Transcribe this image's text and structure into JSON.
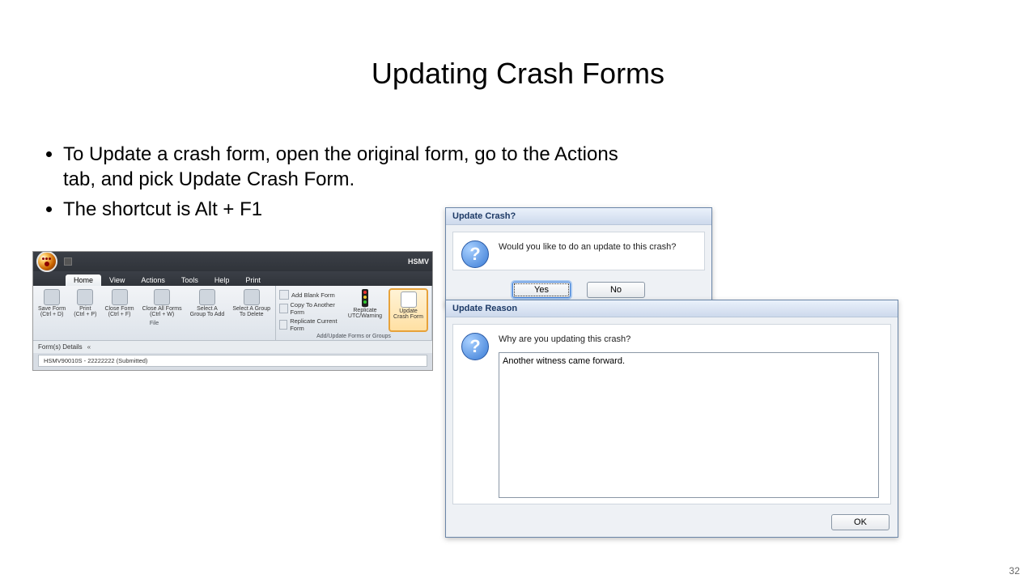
{
  "slide": {
    "title": "Updating Crash Forms",
    "bullets": [
      "To Update a crash form, open the original form, go to the Actions tab, and pick Update Crash Form.",
      "The shortcut is Alt + F1"
    ],
    "page_number": "32"
  },
  "ribbon": {
    "app_title_fragment": "HSMV",
    "tabs": [
      "Home",
      "View",
      "Actions",
      "Tools",
      "Help",
      "Print"
    ],
    "active_tab": "Home",
    "file_group": {
      "name": "File",
      "buttons": [
        {
          "label": "Save Form\n(Ctrl + D)"
        },
        {
          "label": "Print\n(Ctrl + P)"
        },
        {
          "label": "Close Form\n(Ctrl + F)"
        },
        {
          "label": "Close All Forms\n(Ctrl + W)"
        },
        {
          "label": "Select A\nGroup To Add"
        },
        {
          "label": "Select A Group\nTo Delete"
        }
      ]
    },
    "add_group": {
      "name": "Add/Update Forms or Groups",
      "links": [
        "Add Blank Form",
        "Copy To Another Form",
        "Replicate Current Form"
      ],
      "buttons": [
        {
          "label": "Replicate\nUTC/Warning"
        },
        {
          "label": "Update\nCrash Form"
        }
      ]
    },
    "panel_header": "Form(s) Details",
    "panel_collapse": "«",
    "open_doc": "HSMV90010S - 22222222 (Submitted)"
  },
  "update_dialog": {
    "title": "Update Crash?",
    "message": "Would you like to do an update to this crash?",
    "yes": "Yes",
    "no": "No"
  },
  "reason_dialog": {
    "title": "Update Reason",
    "message": "Why are you updating this crash?",
    "value": "Another witness came forward.",
    "ok": "OK"
  }
}
